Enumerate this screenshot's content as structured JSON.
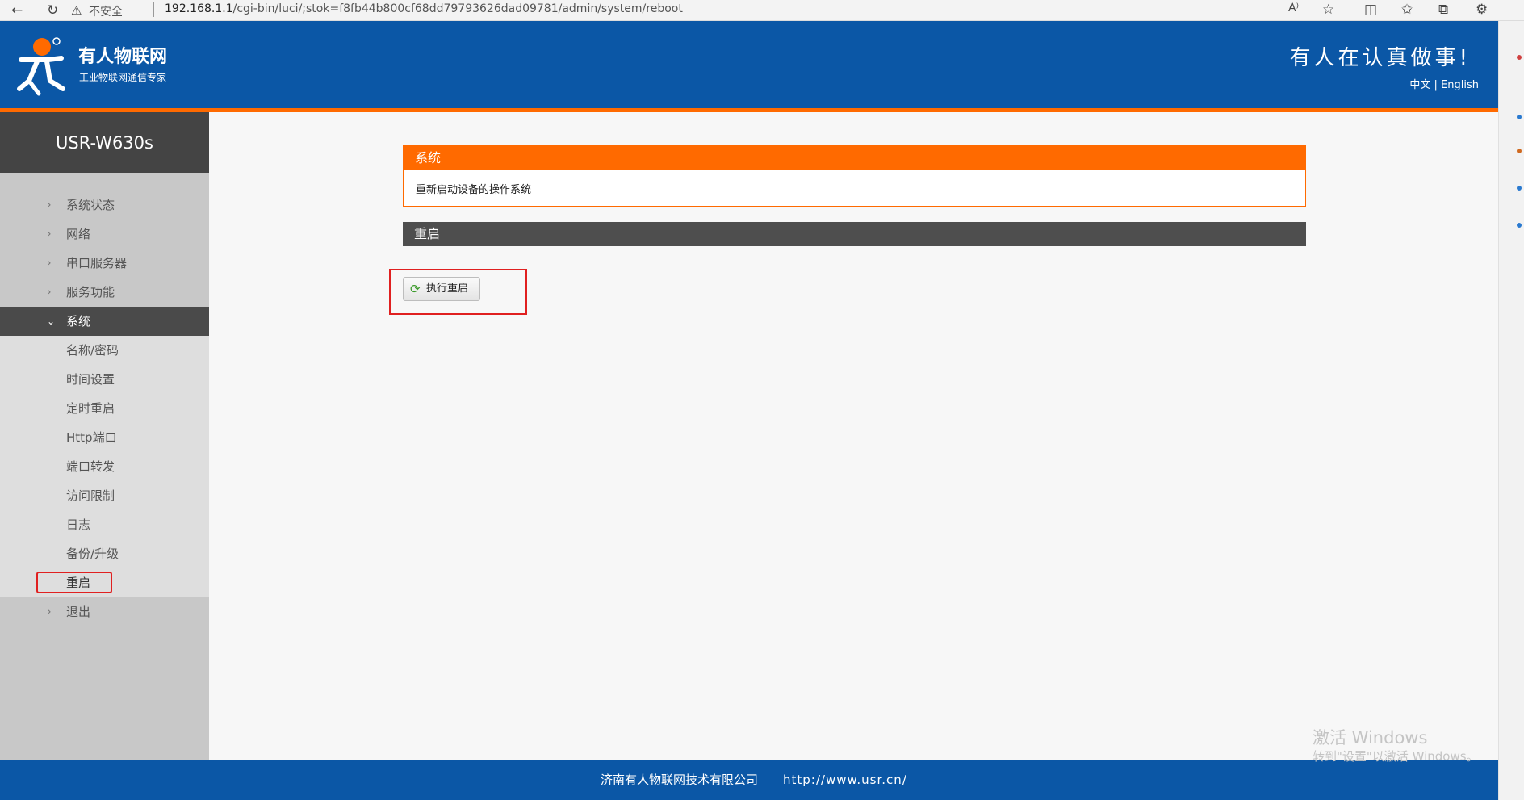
{
  "browser": {
    "security": "不安全",
    "url_host": "192.168.1.1",
    "url_path": "/cgi-bin/luci/;stok=f8fb44b800cf68dd79793626dad09781/admin/system/reboot"
  },
  "header": {
    "brand_name": "有人物联网",
    "brand_sub": "工业物联网通信专家",
    "slogan": "有人在认真做事!",
    "lang_cn": "中文",
    "lang_sep": "|",
    "lang_en": "English"
  },
  "sidebar": {
    "device": "USR-W630s",
    "items": [
      {
        "label": "系统状态"
      },
      {
        "label": "网络"
      },
      {
        "label": "串口服务器"
      },
      {
        "label": "服务功能"
      },
      {
        "label": "系统"
      }
    ],
    "sub_items": [
      {
        "label": "名称/密码"
      },
      {
        "label": "时间设置"
      },
      {
        "label": "定时重启"
      },
      {
        "label": "Http端口"
      },
      {
        "label": "端口转发"
      },
      {
        "label": "访问限制"
      },
      {
        "label": "日志"
      },
      {
        "label": "备份/升级"
      },
      {
        "label": "重启"
      }
    ],
    "logout": "退出"
  },
  "main": {
    "section_title": "系统",
    "section_desc": "重新启动设备的操作系统",
    "reboot_title": "重启",
    "reboot_button": "执行重启"
  },
  "footer": {
    "company": "济南有人物联网技术有限公司",
    "site": "http://www.usr.cn/"
  },
  "watermark": {
    "line1": "激活 Windows",
    "line2": "转到\"设置\"以激活 Windows。"
  },
  "colors": {
    "brand_blue": "#0b57a6",
    "accent_orange": "#ff6a00",
    "highlight_red": "#e02020"
  }
}
